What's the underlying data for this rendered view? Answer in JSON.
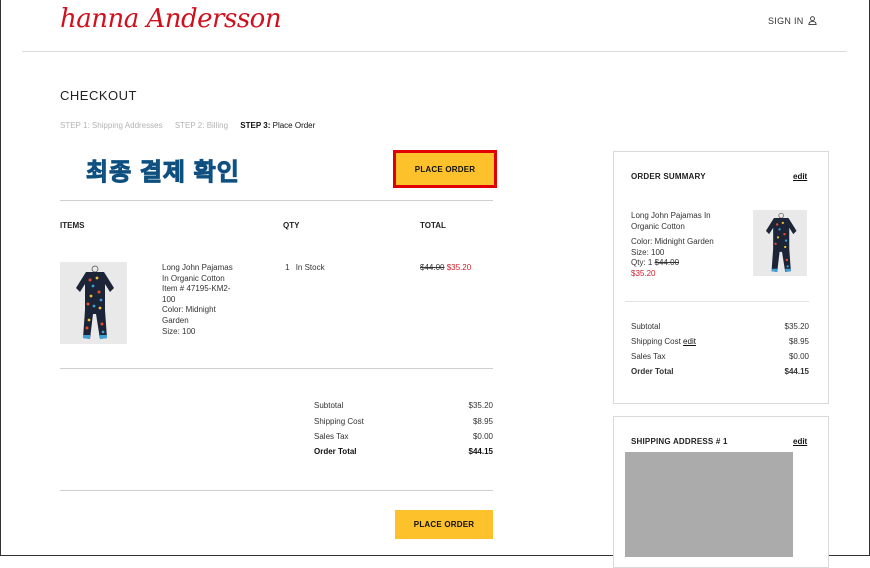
{
  "header": {
    "logo_text": "hanna Andersson",
    "sign_in_label": "SIGN IN"
  },
  "checkout": {
    "title": "CHECKOUT",
    "steps": [
      "STEP 1: Shipping Addresses",
      "STEP 2: Billing"
    ],
    "active_step_prefix": "STEP 3:",
    "active_step_label": "Place Order",
    "korean_annotation": "최종 결제 확인",
    "place_order_label": "PLACE ORDER"
  },
  "items_table": {
    "headers": {
      "items": "ITEMS",
      "qty": "QTY",
      "total": "TOTAL"
    },
    "item": {
      "name_line1": "Long John Pajamas",
      "name_line2": "In Organic Cotton",
      "item_no_line1": "Item # 47195-KM2-",
      "item_no_line2": "100",
      "color_line1": "Color: Midnight",
      "color_line2": "Garden",
      "size": "Size: 100",
      "qty": "1",
      "stock": "In Stock",
      "original_price": "$44.00",
      "sale_price": "$35.20"
    }
  },
  "totals": {
    "subtotal_label": "Subtotal",
    "subtotal_value": "$35.20",
    "shipping_label": "Shipping Cost",
    "shipping_value": "$8.95",
    "tax_label": "Sales Tax",
    "tax_value": "$0.00",
    "order_total_label": "Order Total",
    "order_total_value": "$44.15"
  },
  "order_summary": {
    "title": "ORDER SUMMARY",
    "edit_label": "edit",
    "item_name_line1": "Long John Pajamas In",
    "item_name_line2": "Organic Cotton",
    "color": "Color: Midnight Garden",
    "size": "Size: 100",
    "qty": "Qty: 1",
    "original_price": "$44.00",
    "sale_price": "$35.20",
    "subtotal_label": "Subtotal",
    "subtotal_value": "$35.20",
    "shipping_label": "Shipping Cost",
    "shipping_edit": "edit",
    "shipping_value": "$8.95",
    "tax_label": "Sales Tax",
    "tax_value": "$0.00",
    "order_total_label": "Order Total",
    "order_total_value": "$44.15"
  },
  "shipping_address": {
    "title": "SHIPPING ADDRESS # 1",
    "edit_label": "edit"
  },
  "colors": {
    "brand_red": "#d0101e",
    "button_yellow": "#fdc12b",
    "sale_red": "#d0202b",
    "annotation_blue": "#1b8fd9",
    "highlight_red": "#e00000"
  }
}
